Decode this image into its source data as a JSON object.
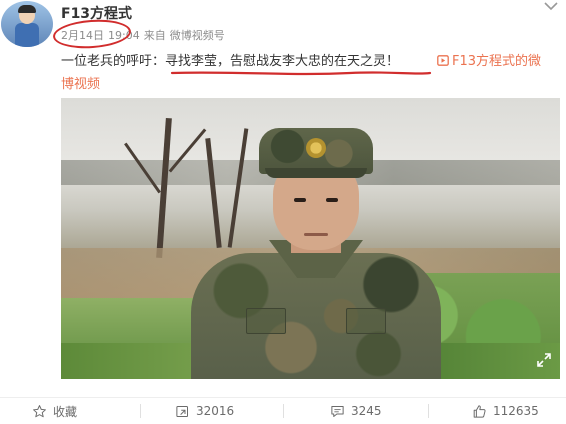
{
  "post": {
    "username": "F13方程式",
    "meta": {
      "date": "2月14日",
      "time": "19:04",
      "source_prefix": "来自",
      "source": "微博视频号"
    },
    "text": {
      "intro": "一位老兵的呼吁：",
      "highlight": "寻找李莹，告慰战友李大忠的在天之灵！"
    },
    "video_link": {
      "part1": "F13方程式的微",
      "part2": "博视频"
    }
  },
  "actions": {
    "favorite": "收藏",
    "repost": "32016",
    "comment": "3245",
    "like": "112635"
  },
  "colors": {
    "link": "#eb7350",
    "annotation_red": "#d12d2d"
  }
}
